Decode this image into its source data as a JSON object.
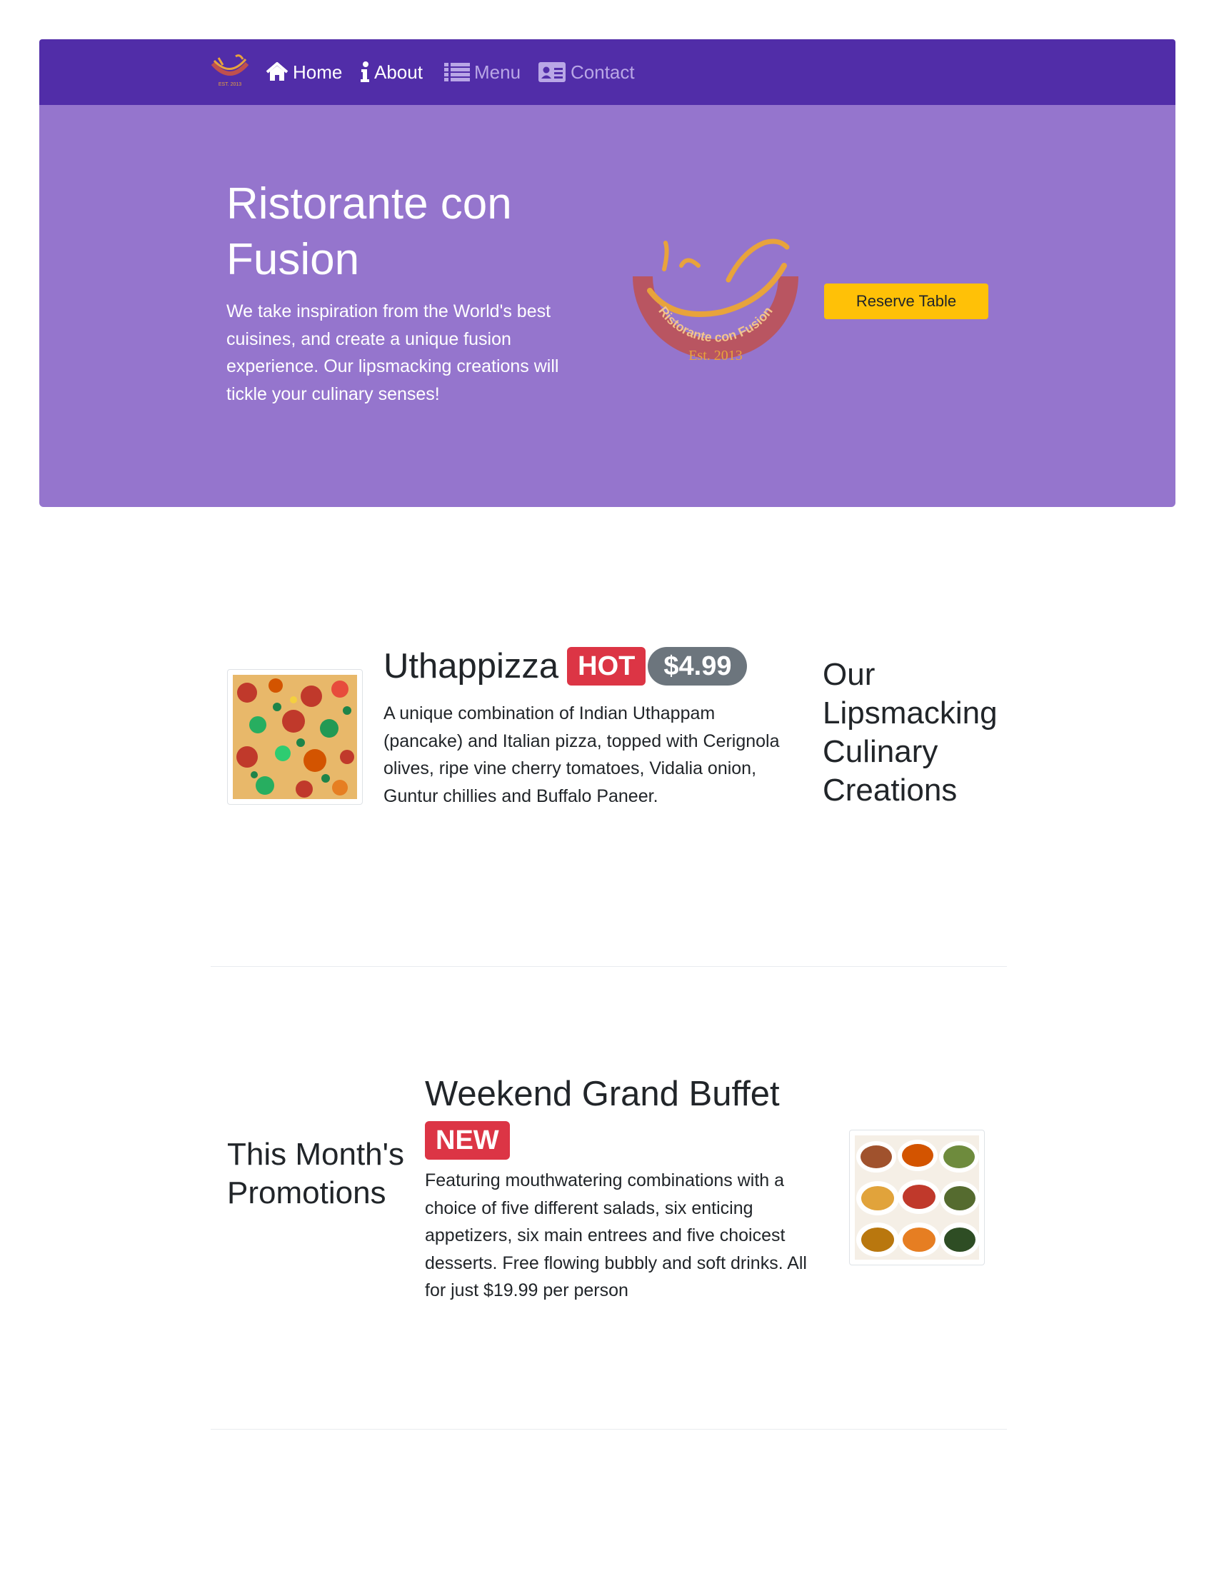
{
  "nav": {
    "logo_icon": "restaurant-logo-icon",
    "items": [
      {
        "label": "Home",
        "icon": "home-icon",
        "active": true
      },
      {
        "label": "About",
        "icon": "info-icon",
        "active": true
      },
      {
        "label": "Menu",
        "icon": "list-icon",
        "active": false
      },
      {
        "label": "Contact",
        "icon": "address-card-icon",
        "active": false
      }
    ]
  },
  "hero": {
    "title": "Ristorante con Fusion",
    "description": "We take inspiration from the World's best cuisines, and create a unique fusion experience. Our lipsmacking creations will tickle your culinary senses!",
    "logo_arc_text": "Ristorante con Fusion",
    "logo_est_text": "Est. 2013",
    "reserve_label": "Reserve Table"
  },
  "featured": {
    "title": "Uthappizza",
    "badge": "HOT",
    "price": "$4.99",
    "description": "A unique combination of Indian Uthappam (pancake) and Italian pizza, topped with Cerignola olives, ripe vine cherry tomatoes, Vidalia onion, Guntur chillies and Buffalo Paneer.",
    "side_heading": "Our Lipsmacking Culinary Creations"
  },
  "promotion": {
    "side_heading": "This Month's Promotions",
    "title": "Weekend Grand Buffet",
    "badge": "NEW",
    "description": "Featuring mouthwatering combinations with a choice of five different salads, six enticing appetizers, six main entrees and five choicest desserts. Free flowing bubbly and soft drinks. All for just $19.99 per person"
  },
  "colors": {
    "navbar": "#512da8",
    "hero": "#9575cd",
    "reserve_button": "#ffc107",
    "badge_danger": "#dc3545",
    "badge_secondary": "#6c757d"
  }
}
